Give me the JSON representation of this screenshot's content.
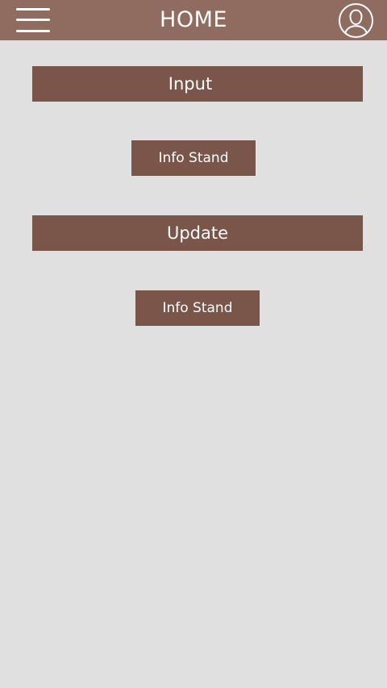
{
  "header": {
    "title": "HOME",
    "menu_icon": "menu-icon",
    "profile_icon": "profile-icon"
  },
  "sections": [
    {
      "label": "Input",
      "button_label": "Info Stand"
    },
    {
      "label": "Update",
      "button_label": "Info Stand"
    }
  ],
  "colors": {
    "app_bar": "#8f6b60",
    "button": "#7a554a",
    "background": "#e0e0e0",
    "text": "#ffffff"
  }
}
